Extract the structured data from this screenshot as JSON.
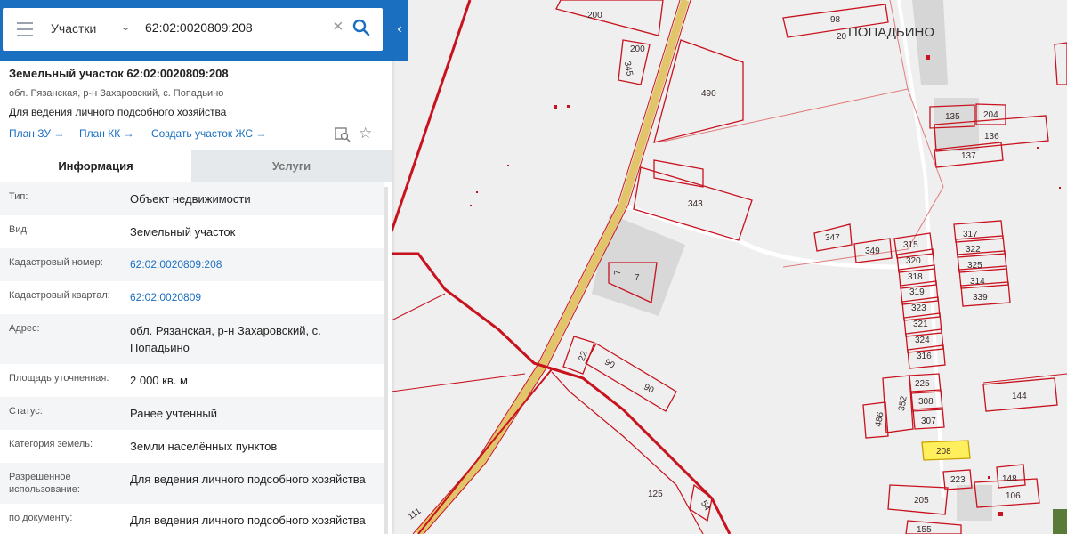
{
  "search": {
    "type_label": "Участки",
    "query": "62:02:0020809:208"
  },
  "card": {
    "title": "Земельный участок 62:02:0020809:208",
    "address": "обл. Рязанская, р-н Захаровский, с. Попадьино",
    "purpose": "Для ведения личного подсобного хозяйства",
    "links": [
      "План ЗУ →",
      "План КК →",
      "Создать участок ЖС →"
    ]
  },
  "tabs": [
    "Информация",
    "Услуги"
  ],
  "info_rows": [
    {
      "key": "Тип:",
      "value": "Объект недвижимости"
    },
    {
      "key": "Вид:",
      "value": "Земельный участок"
    },
    {
      "key": "Кадастровый номер:",
      "value": "62:02:0020809:208"
    },
    {
      "key": "Кадастровый квартал:",
      "value": "62:02:0020809"
    },
    {
      "key": "Адрес:",
      "value": "обл. Рязанская, р-н Захаровский, с. Попадьино"
    },
    {
      "key": "Площадь уточненная:",
      "value": "2 000 кв. м"
    },
    {
      "key": "Статус:",
      "value": "Ранее учтенный"
    },
    {
      "key": "Категория земель:",
      "value": "Земли населённых пунктов"
    },
    {
      "key": "Разрешенное использование:",
      "value": "Для ведения личного подсобного хозяйства"
    },
    {
      "key": "по документу:",
      "value": "Для ведения личного подсобного хозяйства"
    }
  ],
  "map": {
    "village_name": "ПОПАДЬИНО",
    "parcel_labels": [
      "200",
      "200",
      "345",
      "98",
      "20",
      "490",
      "135",
      "204",
      "136",
      "137",
      "343",
      "347",
      "349",
      "315",
      "320",
      "318",
      "319",
      "323",
      "321",
      "324",
      "316",
      "317",
      "322",
      "325",
      "314",
      "339",
      "7",
      "7",
      "22",
      "90",
      "90",
      "225",
      "352",
      "308",
      "486",
      "307",
      "144",
      "208",
      "223",
      "148",
      "106",
      "205",
      "125",
      "54",
      "111",
      "155"
    ],
    "selected_parcel": "208",
    "colors": {
      "boundary": "#c8121e",
      "selected_fill": "#ffef5c",
      "road": "#e2c46a"
    }
  }
}
